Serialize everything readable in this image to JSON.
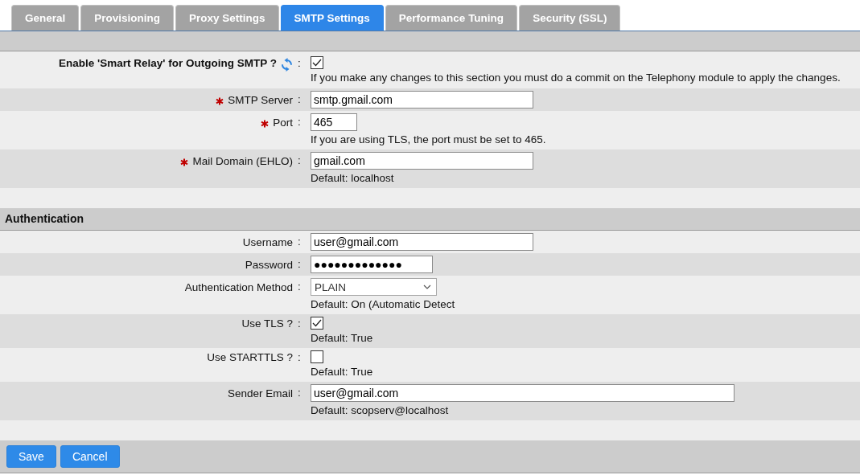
{
  "tabs": [
    {
      "label": "General",
      "selected": false
    },
    {
      "label": "Provisioning",
      "selected": false
    },
    {
      "label": "Proxy Settings",
      "selected": false
    },
    {
      "label": "SMTP Settings",
      "selected": true
    },
    {
      "label": "Performance Tuning",
      "selected": false
    },
    {
      "label": "Security (SSL)",
      "selected": false
    }
  ],
  "sections": [
    {
      "fields": [
        {
          "kind": "main-toggle",
          "label": "Enable 'Smart Relay' for Outgoing SMTP ?",
          "required": false,
          "separator": ":",
          "checked": true,
          "hint": "If you make any changes to this section you must do a commit on the Telephony module to apply the changes."
        },
        {
          "kind": "text",
          "label": "SMTP Server",
          "required": true,
          "separator": ":",
          "value": "smtp.gmail.com"
        },
        {
          "kind": "port",
          "label": "Port",
          "required": true,
          "separator": ":",
          "value": "465",
          "hint": "If you are using TLS, the port must be set to 465."
        },
        {
          "kind": "text",
          "label": "Mail Domain (EHLO)",
          "required": true,
          "separator": ":",
          "value": "gmail.com",
          "hint": "Default: localhost"
        }
      ]
    },
    {
      "title": "Authentication",
      "fields": [
        {
          "kind": "text",
          "label": "Username",
          "required": false,
          "separator": ":",
          "value": "user@gmail.com"
        },
        {
          "kind": "password",
          "label": "Password",
          "required": false,
          "separator": ":",
          "value": "●●●●●●●●●●●●●"
        },
        {
          "kind": "select",
          "label": "Authentication Method",
          "required": false,
          "separator": ":",
          "value": "PLAIN",
          "hint": "Default: On (Automatic Detect"
        },
        {
          "kind": "checkbox",
          "label": "Use TLS ?",
          "required": false,
          "separator": ":",
          "checked": true,
          "hint": "Default: True"
        },
        {
          "kind": "checkbox",
          "label": "Use STARTTLS ?",
          "required": false,
          "separator": ":",
          "checked": false,
          "hint": "Default: True"
        },
        {
          "kind": "long-text",
          "label": "Sender Email",
          "required": false,
          "separator": ":",
          "value": "user@gmail.com",
          "hint": "Default: scopserv@localhost"
        }
      ]
    }
  ],
  "buttons": [
    {
      "label": "Save"
    },
    {
      "label": "Cancel"
    }
  ]
}
